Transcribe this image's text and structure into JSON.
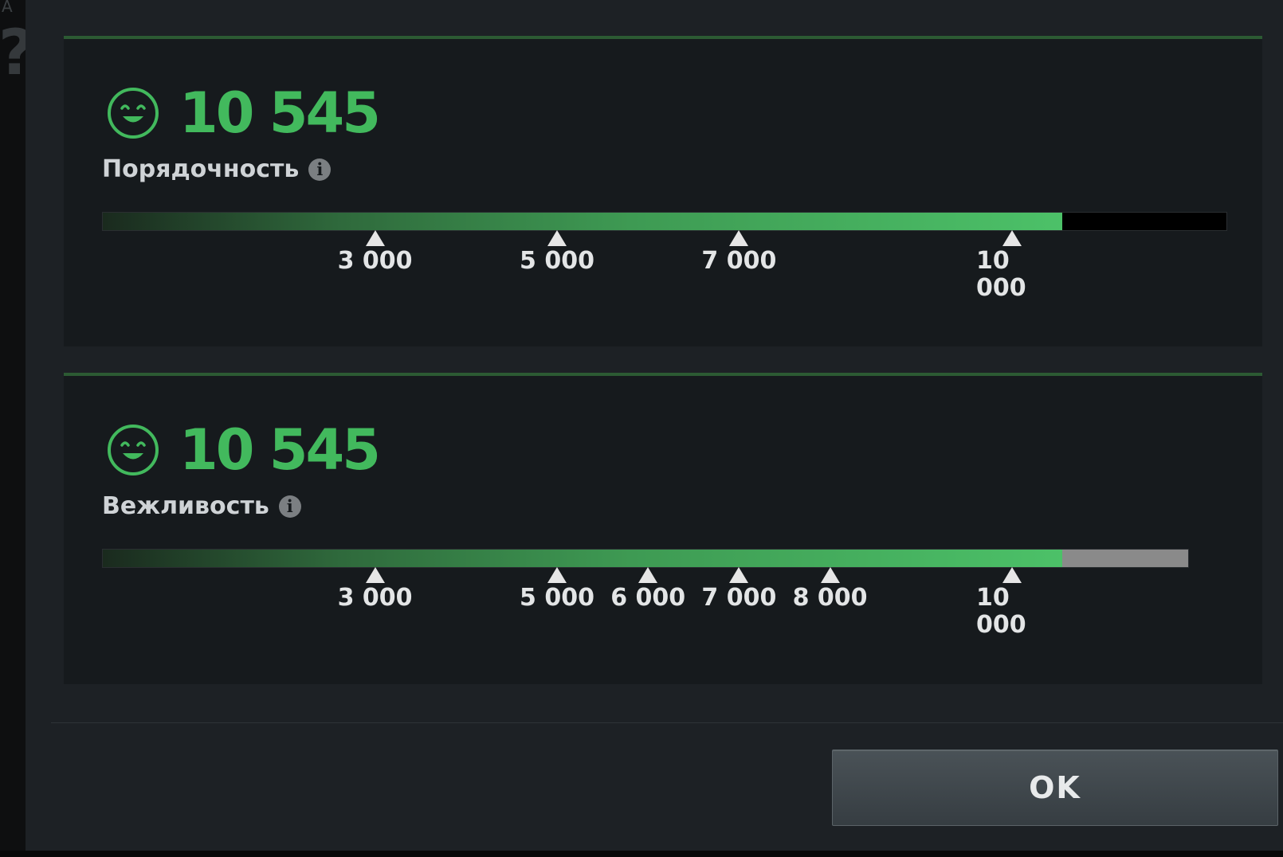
{
  "colors": {
    "accent_green": "#42b95d",
    "panel_background": "#161a1d",
    "dialog_background": "#1d2125"
  },
  "sidebar": {
    "glyph_a": "A",
    "glyph_q": "?"
  },
  "scores": [
    {
      "value": "10 545",
      "label": "Порядочность",
      "icon": "smiling-face-icon",
      "info_icon": "info-icon",
      "progress": {
        "value": 10545,
        "max": 12000,
        "remaining_color": "#000000"
      },
      "milestones": [
        {
          "value": 3000,
          "label": "3 000"
        },
        {
          "value": 5000,
          "label": "5 000"
        },
        {
          "value": 7000,
          "label": "7 000"
        },
        {
          "value": 10000,
          "label": "10 000"
        }
      ]
    },
    {
      "value": "10 545",
      "label": "Вежливость",
      "icon": "smiling-face-icon",
      "info_icon": "info-icon",
      "progress": {
        "value": 10545,
        "max": 11600,
        "remaining_color": "#8a8a8a"
      },
      "milestones": [
        {
          "value": 3000,
          "label": "3 000"
        },
        {
          "value": 5000,
          "label": "5 000"
        },
        {
          "value": 6000,
          "label": "6 000"
        },
        {
          "value": 7000,
          "label": "7 000"
        },
        {
          "value": 8000,
          "label": "8 000"
        },
        {
          "value": 10000,
          "label": "10 000"
        }
      ]
    }
  ],
  "footer": {
    "ok_label": "OK"
  }
}
